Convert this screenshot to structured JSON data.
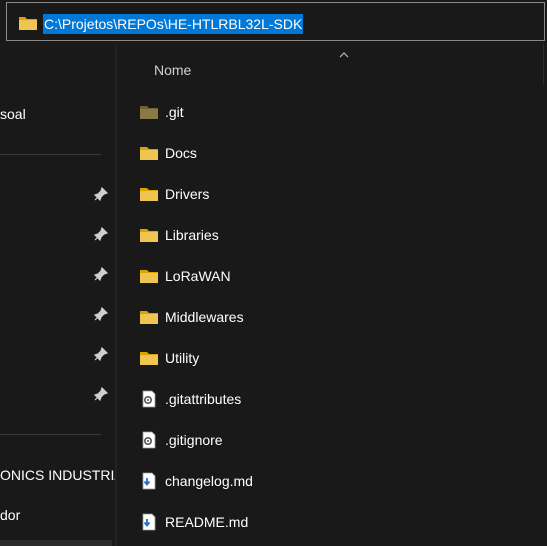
{
  "address_bar": {
    "path": "C:\\Projetos\\REPOs\\HE-HTLRBL32L-SDK",
    "icon": "folder-icon",
    "selection_color": "#0078d7"
  },
  "nav_pane": {
    "items": [
      {
        "label": "soal"
      },
      {
        "label": "ONICS INDUSTRIA"
      },
      {
        "label": "dor"
      }
    ],
    "pinned_count": 6
  },
  "file_list": {
    "column_header": "Nome",
    "sort": "ascending",
    "items": [
      {
        "name": ".git",
        "type": "folder-hidden",
        "icon": "folder-icon"
      },
      {
        "name": "Docs",
        "type": "folder",
        "icon": "folder-icon"
      },
      {
        "name": "Drivers",
        "type": "folder",
        "icon": "folder-icon"
      },
      {
        "name": "Libraries",
        "type": "folder",
        "icon": "folder-icon"
      },
      {
        "name": "LoRaWAN",
        "type": "folder",
        "icon": "folder-icon"
      },
      {
        "name": "Middlewares",
        "type": "folder",
        "icon": "folder-icon"
      },
      {
        "name": "Utility",
        "type": "folder",
        "icon": "folder-icon"
      },
      {
        "name": ".gitattributes",
        "type": "config-file",
        "icon": "gear-file-icon"
      },
      {
        "name": ".gitignore",
        "type": "config-file",
        "icon": "gear-file-icon"
      },
      {
        "name": "changelog.md",
        "type": "markdown-file",
        "icon": "markdown-file-icon"
      },
      {
        "name": "README.md",
        "type": "markdown-file",
        "icon": "markdown-file-icon"
      }
    ]
  },
  "colors": {
    "background": "#191919",
    "folder": "#f0c451",
    "folder_hidden": "#8a7a44",
    "text": "#ffffff"
  }
}
